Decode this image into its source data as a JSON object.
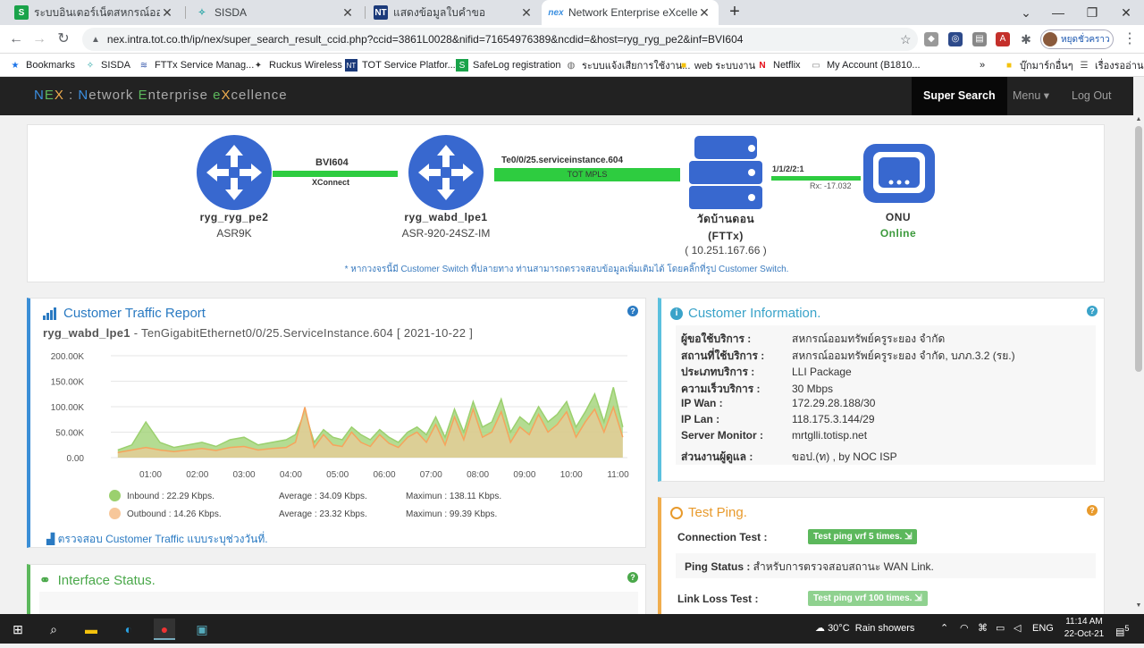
{
  "browser": {
    "tabs": [
      {
        "title": "ระบบอินเตอร์เน็ตสหกรณ์ออมทรัพย์ครู",
        "icon": "safelog-icon",
        "color": "#1aa34a"
      },
      {
        "title": "SISDA",
        "icon": "sisda-icon",
        "color": "#2aa6a6"
      },
      {
        "title": "แสดงข้อมูลใบคำขอ",
        "icon": "nt-icon",
        "color": "#1b3a7a"
      },
      {
        "title": "Network Enterprise eXcellence",
        "icon": "nex-icon",
        "color": "#3b8fe0"
      }
    ],
    "url": "nex.intra.tot.co.th/ip/nex/super_search_result_ccid.php?ccid=3861L0028&nifid=71654976389&ncdid=&host=ryg_ryg_pe2&inf=BVI604",
    "profile_label": "หยุดชั่วคราว",
    "bookmarks": [
      {
        "label": "Bookmarks",
        "icon": "star-icon"
      },
      {
        "label": "SISDA",
        "icon": "sisda-icon"
      },
      {
        "label": "FTTx Service Manag...",
        "icon": "fttx-icon"
      },
      {
        "label": "Ruckus Wireless",
        "icon": "ruckus-icon"
      },
      {
        "label": "TOT Service Platfor...",
        "icon": "nt-icon"
      },
      {
        "label": "SafeLog registration",
        "icon": "safelog-icon"
      },
      {
        "label": "ระบบแจ้งเสียการใช้งาน...",
        "icon": "globe-icon"
      },
      {
        "label": "web ระบบงาน",
        "icon": "folder-icon"
      },
      {
        "label": "Netflix",
        "icon": "netflix-icon"
      },
      {
        "label": "My Account (B1810...",
        "icon": "account-icon"
      },
      {
        "label": "»",
        "icon": ""
      },
      {
        "label": "บุ๊กมาร์กอื่นๆ",
        "icon": "folder-icon"
      },
      {
        "label": "เรื่องรออ่าน",
        "icon": "reading-list-icon"
      }
    ]
  },
  "app": {
    "brand": {
      "n1": "N",
      "e1": "E",
      "x1": "X",
      "sep": " : ",
      "n2": "N",
      "w2": "etwork ",
      "e2": "E",
      "w3": "nterprise ",
      "e3": "e",
      "x3": "X",
      "w4": "cellence"
    },
    "nav": {
      "super_search": "Super Search",
      "menu": "Menu",
      "logout": "Log Out"
    }
  },
  "topology": {
    "node1": {
      "name": "ryg_ryg_pe2",
      "model": "ASR9K"
    },
    "link1": {
      "top": "BVI604",
      "bottom": "XConnect"
    },
    "node2": {
      "name": "ryg_wabd_lpe1",
      "model": "ASR-920-24SZ-IM"
    },
    "link2": {
      "top": "Te0/0/25.serviceinstance.604",
      "inner": "TOT MPLS"
    },
    "node3": {
      "name": "วัดบ้านดอน",
      "type": "(FTTx)",
      "ip": "( 10.251.167.66 )"
    },
    "link3": {
      "top": "1/1/2/2:1",
      "bottom": "Rx: -17.032"
    },
    "node4": {
      "name": "ONU",
      "status": "Online"
    },
    "note": "* หากวงจรนี้มี Customer Switch ที่ปลายทาง ท่านสามารถตรวจสอบข้อมูลเพิ่มเติมได้ โดยคลิ๊กที่รูป Customer Switch."
  },
  "traffic": {
    "title": "Customer Traffic Report",
    "host": "ryg_wabd_lpe1",
    "dash": " - ",
    "interface": "TenGigabitEthernet0/0/25.ServiceInstance.604 [ 2021-10-22 ]",
    "legend": {
      "inbound": "Inbound : 22.29 Kbps.",
      "inbound_avg": "Average : 34.09 Kbps.",
      "inbound_max": "Maximun : 138.11 Kbps.",
      "outbound": "Outbound : 14.26 Kbps.",
      "outbound_avg": "Average : 23.32 Kbps.",
      "outbound_max": "Maximun : 99.39 Kbps."
    },
    "link": "ตรวจสอบ Customer Traffic แบบระบุช่วงวันที่.",
    "colors": {
      "inbound": "#9bd06e",
      "outbound": "#f7a35c"
    }
  },
  "chart_data": {
    "type": "area",
    "title": "",
    "xlabel": "",
    "ylabel": "",
    "ylim": [
      0,
      200000
    ],
    "yticks": [
      "0.00",
      "50.00K",
      "100.00K",
      "150.00K",
      "200.00K"
    ],
    "yticks_values": [
      0,
      50000,
      100000,
      150000,
      200000
    ],
    "xticks": [
      "01:00",
      "02:00",
      "03:00",
      "04:00",
      "05:00",
      "06:00",
      "07:00",
      "08:00",
      "09:00",
      "10:00",
      "11:00"
    ],
    "x_hours": [
      0.3,
      0.6,
      0.9,
      1.2,
      1.5,
      1.8,
      2.1,
      2.4,
      2.7,
      3.0,
      3.3,
      3.6,
      3.9,
      4.1,
      4.3,
      4.5,
      4.7,
      4.9,
      5.1,
      5.3,
      5.5,
      5.7,
      5.9,
      6.1,
      6.3,
      6.5,
      6.7,
      6.9,
      7.1,
      7.3,
      7.5,
      7.7,
      7.9,
      8.1,
      8.3,
      8.5,
      8.7,
      8.9,
      9.1,
      9.3,
      9.5,
      9.7,
      9.9,
      10.1,
      10.3,
      10.5,
      10.7,
      10.9,
      11.1
    ],
    "series": [
      {
        "name": "Inbound",
        "values": [
          15000,
          25000,
          70000,
          30000,
          20000,
          25000,
          30000,
          22000,
          35000,
          40000,
          25000,
          30000,
          35000,
          45000,
          90000,
          30000,
          55000,
          40000,
          35000,
          60000,
          45000,
          35000,
          55000,
          40000,
          30000,
          50000,
          60000,
          45000,
          80000,
          40000,
          95000,
          50000,
          110000,
          60000,
          70000,
          115000,
          50000,
          80000,
          65000,
          100000,
          70000,
          85000,
          110000,
          60000,
          90000,
          125000,
          70000,
          138000,
          60000
        ]
      },
      {
        "name": "Outbound",
        "values": [
          10000,
          15000,
          20000,
          15000,
          12000,
          15000,
          18000,
          14000,
          20000,
          22000,
          15000,
          18000,
          20000,
          30000,
          99000,
          20000,
          45000,
          25000,
          22000,
          50000,
          30000,
          22000,
          45000,
          28000,
          20000,
          40000,
          50000,
          30000,
          65000,
          25000,
          80000,
          35000,
          95000,
          40000,
          50000,
          90000,
          30000,
          60000,
          45000,
          85000,
          50000,
          65000,
          90000,
          40000,
          70000,
          95000,
          50000,
          99000,
          40000
        ]
      }
    ]
  },
  "info": {
    "title": "Customer Information.",
    "rows": [
      {
        "k": "ผู้ขอใช้บริการ :",
        "v": "สหกรณ์ออมทรัพย์ครูระยอง จำกัด"
      },
      {
        "k": "สถานที่ใช้บริการ :",
        "v": "สหกรณ์ออมทรัพย์ครูระยอง จำกัด, บภภ.3.2 (รย.)"
      },
      {
        "k": "ประเภทบริการ :",
        "v": "LLI Package"
      },
      {
        "k": "ความเร็วบริการ :",
        "v": "30 Mbps"
      },
      {
        "k": "IP Wan :",
        "v": "172.29.28.188/30"
      },
      {
        "k": "IP Lan :",
        "v": "118.175.3.144/29"
      },
      {
        "k": "Server Monitor :",
        "v": "mrtglli.totisp.net"
      },
      {
        "k": "ส่วนงานผู้ดูแล :",
        "v": "ขอป.(ท) , by NOC ISP"
      }
    ]
  },
  "ping": {
    "title": "Test Ping.",
    "connection_label": "Connection Test :",
    "connection_btn": "Test ping vrf 5 times.",
    "status_label": "Ping Status :",
    "status_text": " สำหรับการตรวจสอบสถานะ WAN Link.",
    "loss_label": "Link Loss Test :",
    "loss_btn": "Test ping vrf 100 times."
  },
  "iface": {
    "title": "Interface Status."
  },
  "taskbar": {
    "weather": "30°C  Rain showers",
    "lang": "ENG",
    "time": "11:14 AM",
    "date": "22-Oct-21",
    "notif": "5"
  }
}
